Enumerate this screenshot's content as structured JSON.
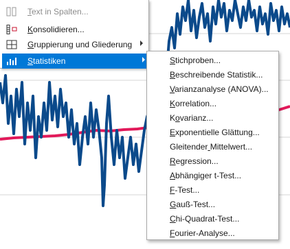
{
  "colors": {
    "highlight": "#0078d7",
    "series_blue": "#0b4a8b",
    "trend_pink": "#e2195a",
    "grid": "#d6d6d6"
  },
  "parent_menu": {
    "items": [
      {
        "label": "Text in Spalten...",
        "mnemonic_index": 0,
        "icon": "text-to-columns-icon",
        "disabled": true,
        "has_submenu": false
      },
      {
        "label": "Konsolidieren...",
        "mnemonic_index": 0,
        "icon": "consolidate-icon",
        "disabled": false,
        "has_submenu": false
      },
      {
        "label": "Gruppierung und Gliederung",
        "mnemonic_index": 0,
        "icon": "group-outline-icon",
        "disabled": false,
        "has_submenu": true
      },
      {
        "label": "Statistiken",
        "mnemonic_index": 0,
        "icon": "statistics-icon",
        "disabled": false,
        "has_submenu": true,
        "highlighted": true
      }
    ]
  },
  "submenu": {
    "items": [
      {
        "label": "Stichproben...",
        "mnemonic_index": 0
      },
      {
        "label": "Beschreibende Statistik...",
        "mnemonic_index": 0
      },
      {
        "label": "Varianzanalyse (ANOVA)...",
        "mnemonic_index": 0
      },
      {
        "label": "Korrelation...",
        "mnemonic_index": 0
      },
      {
        "label": "Kovarianz...",
        "mnemonic_index": 1
      },
      {
        "label": "Exponentielle Glättung...",
        "mnemonic_index": 0
      },
      {
        "label": "Gleitender Mittelwert...",
        "mnemonic_index": 10
      },
      {
        "label": "Regression...",
        "mnemonic_index": 0
      },
      {
        "label": "Abhängiger t-Test...",
        "mnemonic_index": 0
      },
      {
        "label": "F-Test...",
        "mnemonic_index": 0
      },
      {
        "label": "Gauß-Test...",
        "mnemonic_index": 0
      },
      {
        "label": "Chi-Quadrat-Test...",
        "mnemonic_index": 0
      },
      {
        "label": "Fourier-Analyse...",
        "mnemonic_index": 0
      }
    ]
  }
}
